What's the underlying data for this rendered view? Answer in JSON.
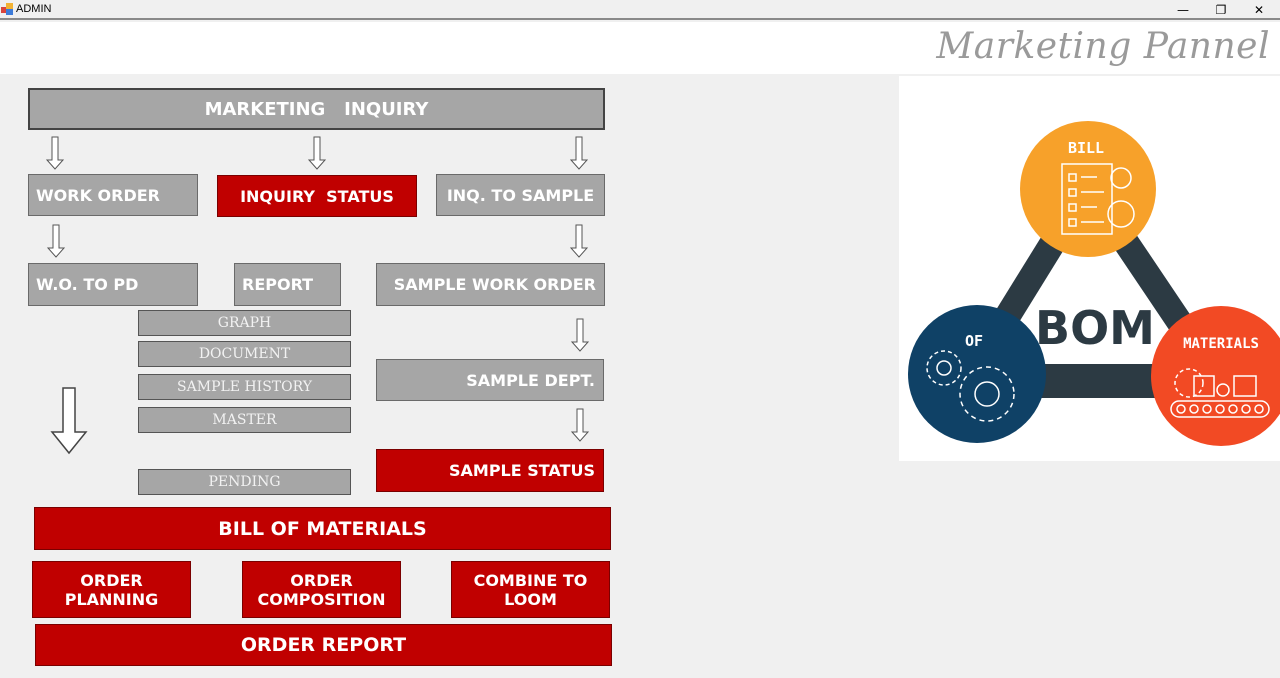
{
  "window": {
    "title": "ADMIN",
    "minimize_glyph": "—",
    "restore_glyph": "❐",
    "close_glyph": "✕"
  },
  "header": {
    "title": "Marketing Pannel"
  },
  "flow": {
    "marketing_inquiry": "MARKETING   INQUIRY",
    "work_order": "WORK ORDER",
    "inquiry_status": "INQUIRY  STATUS",
    "inq_to_sample": "INQ. TO SAMPLE",
    "wo_to_pd": "W.O. TO PD",
    "report": "REPORT",
    "sample_work_order": "SAMPLE WORK ORDER",
    "graph": "GRAPH",
    "document": "DOCUMENT",
    "sample_history": "SAMPLE HISTORY",
    "master": "MASTER",
    "pending": "PENDING",
    "sample_dept": "SAMPLE DEPT.",
    "sample_status": "SAMPLE STATUS",
    "bill_of_materials": "BILL OF MATERIALS",
    "order_planning": [
      "ORDER",
      "PLANNING"
    ],
    "order_composition": [
      "ORDER",
      "COMPOSITION"
    ],
    "combine_to_loom": [
      "COMBINE TO",
      "LOOM"
    ],
    "order_report": "ORDER REPORT"
  },
  "bom_graphic": {
    "center": "BOM",
    "top": "BILL",
    "left": "OF",
    "right": "MATERIALS",
    "colors": {
      "top": "#f7a12a",
      "left": "#0f4166",
      "right": "#f24a24",
      "frame": "#2c3a43"
    }
  },
  "colors": {
    "gray_button": "#a6a6a6",
    "red_button": "#c00000",
    "header_text": "#9a9a9a"
  }
}
